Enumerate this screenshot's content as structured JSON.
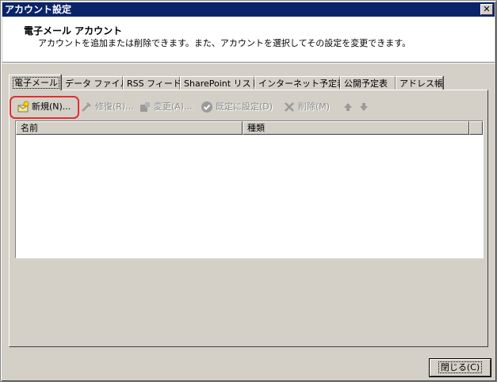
{
  "window": {
    "title": "アカウント設定",
    "close_glyph": "✕"
  },
  "header": {
    "title": "電子メール アカウント",
    "description": "アカウントを追加または削除できます。また、アカウントを選択してその設定を変更できます。"
  },
  "tabs": [
    {
      "label": "電子メール",
      "active": true
    },
    {
      "label": "データ ファイル"
    },
    {
      "label": "RSS フィード"
    },
    {
      "label": "SharePoint リスト"
    },
    {
      "label": "インターネット予定表"
    },
    {
      "label": "公開予定表"
    },
    {
      "label": "アドレス帳"
    }
  ],
  "toolbar": {
    "new_label": "新規(N)...",
    "repair_label": "修復(R)...",
    "change_label": "変更(A)...",
    "default_label": "既定に設定(D)",
    "delete_label": "削除(M)",
    "icons": [
      "new-account-icon",
      "repair-icon",
      "change-icon",
      "default-check-icon",
      "delete-x-icon",
      "move-up-icon",
      "move-down-icon"
    ]
  },
  "list": {
    "columns": [
      "名前",
      "種類"
    ],
    "rows": []
  },
  "footer": {
    "close_label": "閉じる(C)"
  },
  "colors": {
    "titlebar": "#0a246a",
    "face": "#d4d0c8",
    "highlight_outline": "#e03030"
  }
}
